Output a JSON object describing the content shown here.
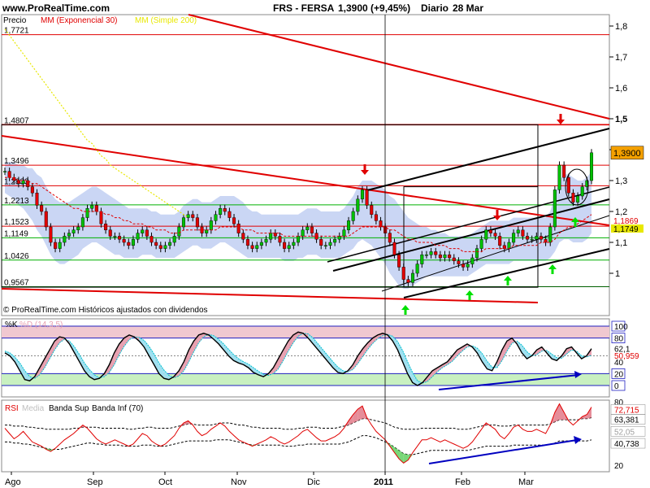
{
  "header": {
    "site": "www.ProRealTime.com",
    "symbol": "FRS - FERSA",
    "quote": "1,3900 (+9,45%)",
    "period": "Diario",
    "date": "28 Mar"
  },
  "colors": {
    "candle_up": "#00c000",
    "candle_down": "#e00000",
    "ema": "#e00000",
    "sma": "#e8e800",
    "band_fill": "#b8c8f0",
    "trend_red": "#e00000",
    "channel": "#000000",
    "stoch_k": "#000000",
    "stoch_d": "#00c0d0",
    "stoch_fill_pos": "#e8a0b0",
    "stoch_fill_neg": "#a0e0f0",
    "rsi": "#e00000",
    "rsi_fill_pos": "#e07080",
    "rsi_fill_neg": "#60d060",
    "arrow_up": "#00e000",
    "arrow_down": "#e00000",
    "divergence": "#0000c0"
  },
  "chart_data": [
    {
      "type": "candlestick",
      "legend": [
        "Precio",
        "MM (Exponencial 30)",
        "MM (Simple 200)"
      ],
      "footer": "© ProRealTime.com  Históricos ajustados con dividendos",
      "yaxis_ticks": [
        "1,8",
        "1,7",
        "1,6",
        "1,5",
        "1,4",
        "1,3",
        "1,2",
        "1,1",
        "1"
      ],
      "ylim": [
        0.95,
        1.83
      ],
      "price_labels": [
        "1,7721",
        "1,4807",
        "1,3496",
        "1,2833",
        "1,2213",
        "1,1523",
        "1,1149",
        "1,0426",
        "0,9567"
      ],
      "last_price": "1,3900",
      "ema_value_label": "1,1869",
      "sma_value_label": "1,1749",
      "x_months": [
        "Ago",
        "Sep",
        "Oct",
        "Nov",
        "Dic",
        "2011",
        "Feb",
        "Mar"
      ],
      "close": [
        1.33,
        1.31,
        1.3,
        1.29,
        1.3,
        1.28,
        1.26,
        1.22,
        1.2,
        1.15,
        1.1,
        1.08,
        1.1,
        1.12,
        1.13,
        1.14,
        1.15,
        1.18,
        1.21,
        1.22,
        1.2,
        1.16,
        1.14,
        1.12,
        1.12,
        1.11,
        1.1,
        1.09,
        1.11,
        1.13,
        1.14,
        1.12,
        1.1,
        1.09,
        1.08,
        1.09,
        1.1,
        1.12,
        1.15,
        1.18,
        1.19,
        1.18,
        1.15,
        1.13,
        1.14,
        1.17,
        1.19,
        1.21,
        1.2,
        1.18,
        1.16,
        1.13,
        1.11,
        1.09,
        1.08,
        1.09,
        1.1,
        1.11,
        1.13,
        1.12,
        1.1,
        1.08,
        1.09,
        1.1,
        1.12,
        1.14,
        1.15,
        1.13,
        1.11,
        1.09,
        1.09,
        1.1,
        1.11,
        1.12,
        1.14,
        1.17,
        1.2,
        1.24,
        1.27,
        1.22,
        1.19,
        1.17,
        1.15,
        1.13,
        1.1,
        1.06,
        1.02,
        0.98,
        0.97,
        1.0,
        1.03,
        1.06,
        1.06,
        1.07,
        1.06,
        1.05,
        1.06,
        1.05,
        1.04,
        1.03,
        1.02,
        1.03,
        1.05,
        1.08,
        1.11,
        1.14,
        1.13,
        1.12,
        1.09,
        1.08,
        1.1,
        1.13,
        1.14,
        1.12,
        1.11,
        1.11,
        1.12,
        1.11,
        1.1,
        1.15,
        1.27,
        1.35,
        1.31,
        1.26,
        1.23,
        1.25,
        1.28,
        1.3,
        1.39
      ],
      "ema30": [
        1.31,
        1.31,
        1.31,
        1.3,
        1.3,
        1.3,
        1.29,
        1.29,
        1.28,
        1.27,
        1.26,
        1.25,
        1.24,
        1.23,
        1.22,
        1.21,
        1.21,
        1.2,
        1.2,
        1.2,
        1.2,
        1.2,
        1.19,
        1.19,
        1.18,
        1.18,
        1.17,
        1.17,
        1.16,
        1.16,
        1.16,
        1.15,
        1.15,
        1.14,
        1.14,
        1.14,
        1.13,
        1.13,
        1.13,
        1.14,
        1.14,
        1.14,
        1.14,
        1.14,
        1.14,
        1.14,
        1.14,
        1.15,
        1.15,
        1.15,
        1.15,
        1.15,
        1.14,
        1.14,
        1.14,
        1.13,
        1.13,
        1.13,
        1.13,
        1.13,
        1.13,
        1.12,
        1.12,
        1.12,
        1.12,
        1.12,
        1.12,
        1.12,
        1.12,
        1.12,
        1.12,
        1.12,
        1.12,
        1.12,
        1.12,
        1.12,
        1.13,
        1.14,
        1.15,
        1.15,
        1.15,
        1.15,
        1.15,
        1.15,
        1.14,
        1.14,
        1.13,
        1.12,
        1.11,
        1.11,
        1.1,
        1.1,
        1.1,
        1.1,
        1.09,
        1.09,
        1.09,
        1.08,
        1.08,
        1.08,
        1.07,
        1.07,
        1.07,
        1.07,
        1.07,
        1.08,
        1.08,
        1.08,
        1.08,
        1.08,
        1.08,
        1.09,
        1.09,
        1.09,
        1.09,
        1.09,
        1.09,
        1.1,
        1.1,
        1.1,
        1.11,
        1.13,
        1.14,
        1.15,
        1.15,
        1.16,
        1.17,
        1.18,
        1.19
      ],
      "sma200": [
        1.79,
        1.77,
        1.75,
        1.73,
        1.71,
        1.69,
        1.67,
        1.65,
        1.63,
        1.61,
        1.59,
        1.57,
        1.55,
        1.53,
        1.51,
        1.49,
        1.47,
        1.45,
        1.43,
        1.42,
        1.4,
        1.38,
        1.37,
        1.35,
        1.34,
        1.33,
        1.32,
        1.31,
        1.3,
        1.29,
        1.28,
        1.27,
        1.26,
        1.25,
        1.24,
        1.23,
        1.22,
        1.21,
        1.2,
        1.19,
        1.18
      ],
      "band_upper": [
        1.36,
        1.36,
        1.36,
        1.35,
        1.35,
        1.34,
        1.34,
        1.32,
        1.31,
        1.28,
        1.26,
        1.24,
        1.23,
        1.23,
        1.23,
        1.24,
        1.25,
        1.26,
        1.27,
        1.28,
        1.28,
        1.27,
        1.26,
        1.25,
        1.24,
        1.23,
        1.22,
        1.21,
        1.21,
        1.21,
        1.21,
        1.21,
        1.2,
        1.2,
        1.19,
        1.19,
        1.19,
        1.19,
        1.2,
        1.22,
        1.23,
        1.24,
        1.24,
        1.23,
        1.23,
        1.23,
        1.24,
        1.25,
        1.25,
        1.25,
        1.25,
        1.24,
        1.23,
        1.21,
        1.2,
        1.2,
        1.19,
        1.19,
        1.19,
        1.19,
        1.19,
        1.19,
        1.19,
        1.19,
        1.19,
        1.2,
        1.21,
        1.21,
        1.21,
        1.2,
        1.2,
        1.2,
        1.2,
        1.2,
        1.21,
        1.23,
        1.25,
        1.28,
        1.3,
        1.3,
        1.3,
        1.29,
        1.28,
        1.27,
        1.25,
        1.24,
        1.22,
        1.2,
        1.18,
        1.17,
        1.16,
        1.15,
        1.15,
        1.14,
        1.14,
        1.13,
        1.13,
        1.12,
        1.12,
        1.12,
        1.12,
        1.12,
        1.13,
        1.14,
        1.15,
        1.16,
        1.17,
        1.17,
        1.17,
        1.17,
        1.17,
        1.18,
        1.18,
        1.18,
        1.18,
        1.18,
        1.18,
        1.18,
        1.18,
        1.2,
        1.25,
        1.3,
        1.32,
        1.32,
        1.31,
        1.3,
        1.3,
        1.31,
        1.33
      ],
      "band_lower": [
        1.26,
        1.25,
        1.24,
        1.22,
        1.21,
        1.19,
        1.17,
        1.14,
        1.12,
        1.09,
        1.06,
        1.04,
        1.03,
        1.03,
        1.04,
        1.05,
        1.06,
        1.08,
        1.09,
        1.1,
        1.1,
        1.09,
        1.08,
        1.07,
        1.06,
        1.06,
        1.05,
        1.05,
        1.05,
        1.05,
        1.06,
        1.06,
        1.06,
        1.05,
        1.05,
        1.05,
        1.05,
        1.05,
        1.06,
        1.07,
        1.08,
        1.09,
        1.09,
        1.08,
        1.08,
        1.08,
        1.09,
        1.1,
        1.1,
        1.09,
        1.08,
        1.07,
        1.06,
        1.05,
        1.05,
        1.05,
        1.05,
        1.05,
        1.05,
        1.05,
        1.05,
        1.04,
        1.04,
        1.04,
        1.05,
        1.05,
        1.06,
        1.06,
        1.06,
        1.05,
        1.05,
        1.05,
        1.05,
        1.05,
        1.06,
        1.07,
        1.08,
        1.1,
        1.11,
        1.1,
        1.09,
        1.07,
        1.05,
        1.03,
        1.0,
        0.98,
        0.96,
        0.95,
        0.95,
        0.96,
        0.97,
        0.98,
        0.99,
        0.99,
        0.99,
        0.99,
        0.99,
        0.99,
        0.99,
        0.99,
        0.99,
        0.99,
        1.0,
        1.01,
        1.02,
        1.03,
        1.03,
        1.03,
        1.03,
        1.03,
        1.03,
        1.04,
        1.04,
        1.04,
        1.04,
        1.04,
        1.04,
        1.04,
        1.04,
        1.05,
        1.07,
        1.1,
        1.11,
        1.11,
        1.1,
        1.1,
        1.1,
        1.11,
        1.13
      ]
    },
    {
      "type": "line",
      "legend": [
        "%K",
        "%D (14,3,5)"
      ],
      "yaxis_ticks": [
        "100",
        "80",
        "62,1",
        "50,959",
        "40",
        "20",
        "0"
      ],
      "ylim": [
        0,
        100
      ],
      "stoch_k": [
        55,
        50,
        40,
        25,
        10,
        8,
        15,
        30,
        45,
        60,
        75,
        82,
        80,
        70,
        55,
        40,
        25,
        15,
        10,
        12,
        20,
        35,
        55,
        70,
        80,
        85,
        82,
        75,
        65,
        50,
        35,
        20,
        12,
        10,
        15,
        25,
        40,
        60,
        75,
        85,
        88,
        85,
        78,
        70,
        60,
        50,
        42,
        38,
        35,
        30,
        22,
        18,
        15,
        20,
        30,
        45,
        60,
        75,
        85,
        90,
        88,
        80,
        70,
        60,
        50,
        40,
        30,
        22,
        20,
        25,
        35,
        50,
        62,
        72,
        80,
        85,
        88,
        85,
        75,
        60,
        40,
        20,
        5,
        0,
        5,
        15,
        25,
        30,
        35,
        40,
        50,
        60,
        65,
        70,
        65,
        55,
        40,
        28,
        25,
        40,
        60,
        75,
        80,
        70,
        55,
        45,
        50,
        60,
        65,
        55,
        45,
        42,
        50,
        62,
        65,
        55,
        45,
        50,
        62
      ],
      "stoch_d": [
        58,
        55,
        48,
        38,
        25,
        15,
        12,
        18,
        30,
        45,
        60,
        72,
        78,
        75,
        65,
        52,
        38,
        27,
        18,
        13,
        15,
        22,
        35,
        52,
        66,
        77,
        82,
        81,
        76,
        66,
        53,
        38,
        26,
        17,
        13,
        16,
        25,
        40,
        57,
        72,
        82,
        86,
        84,
        78,
        70,
        61,
        52,
        45,
        40,
        36,
        30,
        24,
        19,
        17,
        20,
        28,
        42,
        58,
        72,
        83,
        88,
        87,
        80,
        70,
        60,
        50,
        40,
        31,
        25,
        23,
        27,
        37,
        49,
        61,
        71,
        79,
        84,
        86,
        83,
        74,
        59,
        40,
        22,
        8,
        4,
        7,
        15,
        23,
        30,
        35,
        41,
        50,
        58,
        65,
        67,
        63,
        54,
        41,
        31,
        30,
        42,
        58,
        71,
        75,
        68,
        57,
        50,
        52,
        58,
        59,
        53,
        47,
        46,
        53,
        60,
        58,
        50,
        48,
        51
      ]
    },
    {
      "type": "line",
      "legend": [
        "RSI",
        "Media",
        "Banda Sup",
        "Banda Inf (70)"
      ],
      "yaxis_ticks": [
        "80",
        "72,715",
        "63,381",
        "52,05",
        "40,738",
        "20"
      ],
      "ylim": [
        15,
        85
      ],
      "rsi": [
        55,
        50,
        45,
        48,
        52,
        47,
        42,
        40,
        38,
        35,
        33,
        36,
        40,
        44,
        47,
        50,
        54,
        58,
        55,
        50,
        45,
        42,
        40,
        42,
        44,
        42,
        40,
        38,
        40,
        45,
        50,
        48,
        43,
        40,
        38,
        40,
        44,
        48,
        55,
        60,
        62,
        58,
        52,
        48,
        50,
        54,
        57,
        60,
        57,
        52,
        48,
        44,
        42,
        40,
        38,
        40,
        42,
        44,
        47,
        45,
        42,
        40,
        42,
        45,
        48,
        52,
        54,
        50,
        46,
        43,
        43,
        45,
        47,
        50,
        55,
        62,
        68,
        73,
        76,
        65,
        58,
        52,
        48,
        44,
        38,
        32,
        26,
        22,
        25,
        32,
        38,
        44,
        44,
        46,
        44,
        42,
        44,
        42,
        40,
        38,
        36,
        38,
        42,
        48,
        54,
        60,
        57,
        54,
        48,
        45,
        50,
        56,
        58,
        54,
        52,
        52,
        54,
        52,
        50,
        58,
        70,
        78,
        70,
        62,
        58,
        62,
        66,
        68,
        75
      ],
      "rsi_upper": [
        58,
        58,
        57,
        57,
        57,
        56,
        56,
        55,
        55,
        54,
        54,
        54,
        54,
        54,
        54,
        55,
        55,
        56,
        56,
        56,
        56,
        55,
        55,
        55,
        55,
        55,
        55,
        54,
        54,
        55,
        55,
        56,
        56,
        55,
        55,
        55,
        55,
        56,
        57,
        58,
        59,
        59,
        58,
        58,
        58,
        58,
        59,
        60,
        60,
        60,
        59,
        58,
        58,
        57,
        56,
        56,
        55,
        55,
        55,
        55,
        55,
        54,
        54,
        54,
        55,
        55,
        56,
        56,
        56,
        55,
        55,
        55,
        55,
        56,
        57,
        58,
        60,
        62,
        64,
        64,
        63,
        62,
        61,
        60,
        58,
        56,
        55,
        54,
        54,
        54,
        54,
        55,
        55,
        55,
        55,
        55,
        55,
        55,
        55,
        54,
        54,
        54,
        55,
        56,
        57,
        58,
        58,
        58,
        57,
        57,
        57,
        58,
        58,
        58,
        58,
        58,
        58,
        58,
        58,
        59,
        61,
        63,
        63,
        63,
        63,
        63,
        64,
        64,
        65
      ],
      "rsi_lower": [
        42,
        42,
        41,
        41,
        40,
        40,
        39,
        38,
        37,
        36,
        35,
        35,
        35,
        36,
        37,
        38,
        39,
        40,
        41,
        41,
        40,
        40,
        39,
        39,
        39,
        39,
        38,
        38,
        38,
        38,
        39,
        39,
        39,
        38,
        38,
        38,
        39,
        40,
        41,
        42,
        43,
        43,
        43,
        43,
        43,
        43,
        44,
        44,
        44,
        44,
        43,
        42,
        41,
        40,
        39,
        39,
        39,
        39,
        39,
        39,
        39,
        38,
        38,
        38,
        39,
        39,
        40,
        40,
        40,
        40,
        40,
        40,
        40,
        40,
        41,
        42,
        44,
        46,
        48,
        48,
        47,
        46,
        44,
        42,
        40,
        37,
        34,
        31,
        30,
        30,
        31,
        32,
        33,
        34,
        34,
        34,
        34,
        34,
        34,
        34,
        34,
        34,
        35,
        36,
        37,
        38,
        38,
        38,
        38,
        38,
        38,
        39,
        39,
        39,
        39,
        39,
        39,
        39,
        39,
        40,
        41,
        43,
        43,
        43,
        43,
        43,
        43,
        43,
        44
      ]
    }
  ]
}
